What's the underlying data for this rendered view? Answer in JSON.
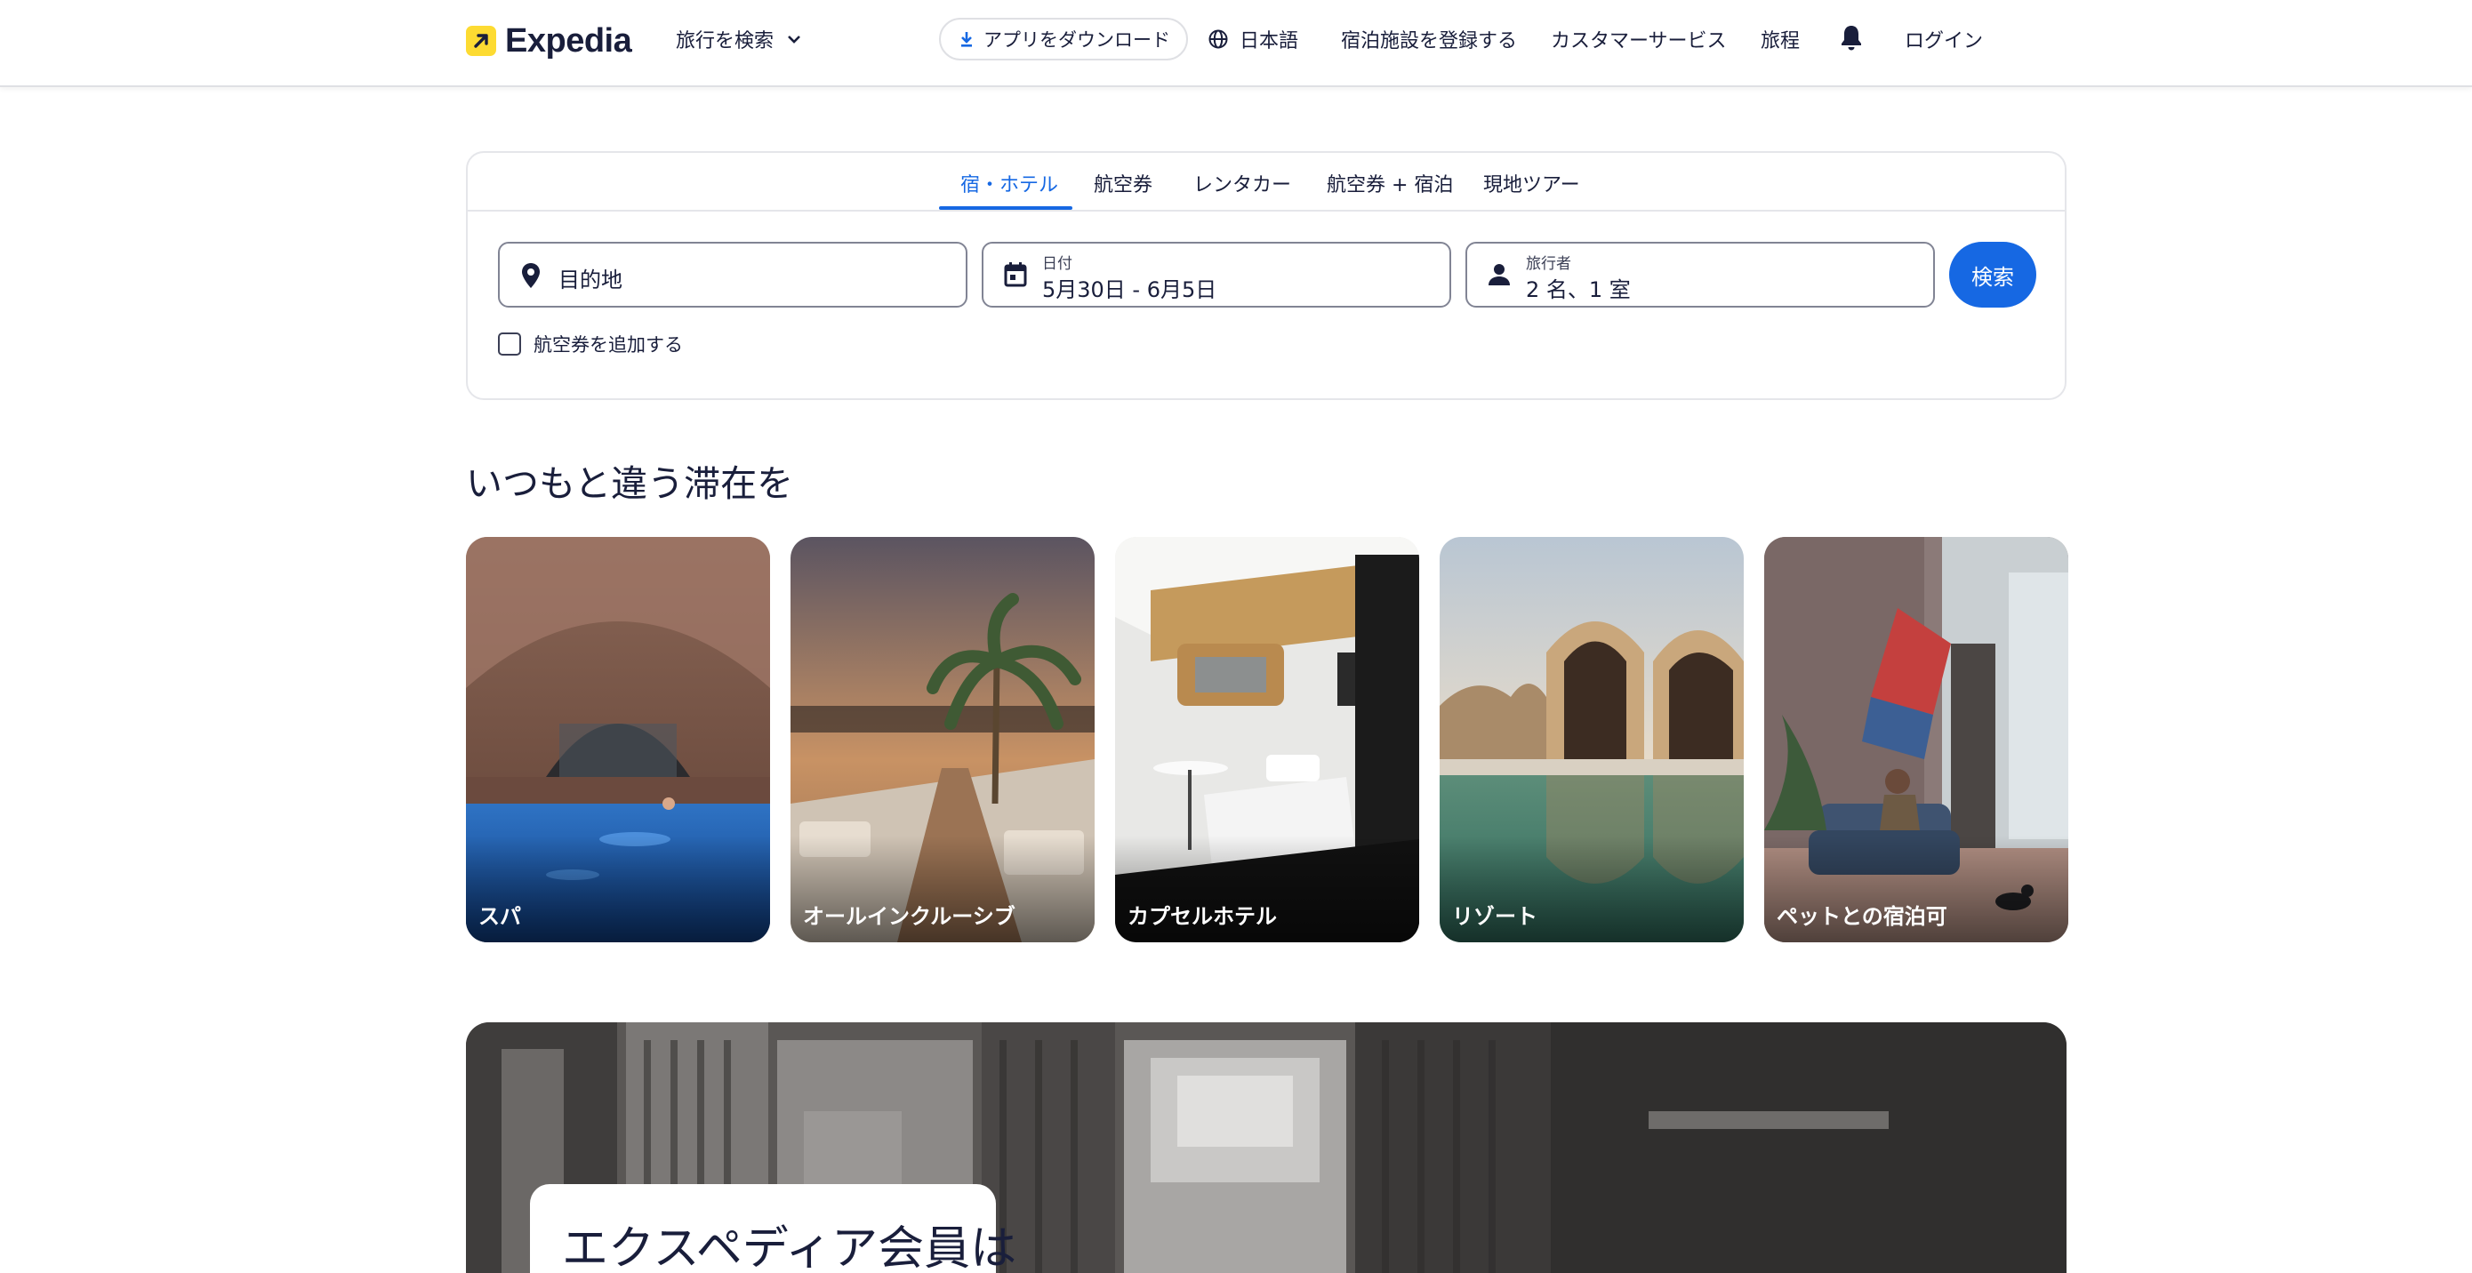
{
  "header": {
    "brand": "Expedia",
    "trip_search": "旅行を検索",
    "app_download": "アプリをダウンロード",
    "language": "日本語",
    "list_property": "宿泊施設を登録する",
    "customer_service": "カスタマーサービス",
    "trips": "旅程",
    "login": "ログイン"
  },
  "search": {
    "tabs": [
      {
        "label": "宿・ホテル",
        "active": true
      },
      {
        "label": "航空券",
        "active": false
      },
      {
        "label": "レンタカー",
        "active": false
      },
      {
        "label": "航空券 + 宿泊",
        "active": false
      },
      {
        "label": "現地ツアー",
        "active": false
      }
    ],
    "destination_placeholder": "目的地",
    "dates_label": "日付",
    "dates_value": "5月30日 - 6月5日",
    "travelers_label": "旅行者",
    "travelers_value": "2 名、1 室",
    "submit": "検索",
    "add_flight_label": "航空券を追加する",
    "add_flight_checked": false
  },
  "section": {
    "title": "いつもと違う滞在を",
    "cards": [
      {
        "label": "スパ"
      },
      {
        "label": "オールインクルーシブ"
      },
      {
        "label": "カプセルホテル"
      },
      {
        "label": "リゾート"
      },
      {
        "label": "ペットとの宿泊可"
      }
    ]
  },
  "promo": {
    "title": "エクスペディア会員は"
  },
  "colors": {
    "accent": "#1668e3",
    "brand_yellow": "#fddb32",
    "text": "#191e3b"
  }
}
